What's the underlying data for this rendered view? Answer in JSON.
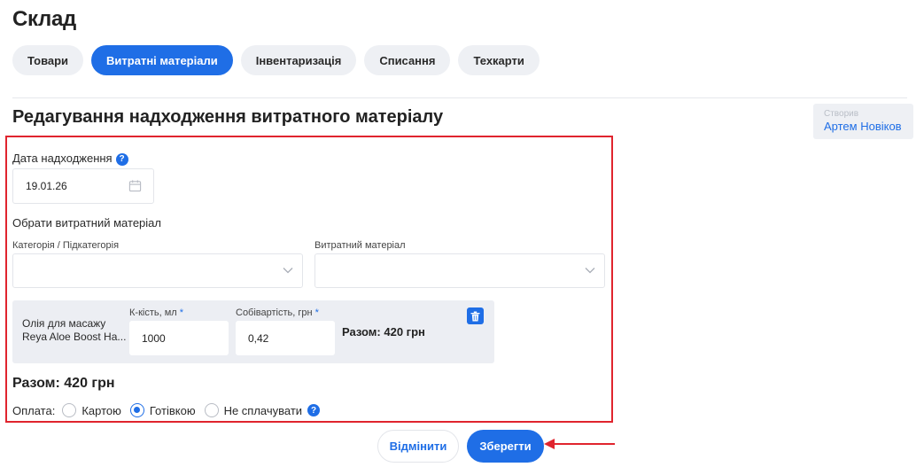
{
  "page": {
    "title": "Склад"
  },
  "tabs": [
    {
      "label": "Товари",
      "active": false
    },
    {
      "label": "Витратні матеріали",
      "active": true
    },
    {
      "label": "Інвентаризація",
      "active": false
    },
    {
      "label": "Списання",
      "active": false
    },
    {
      "label": "Техкарти",
      "active": false
    }
  ],
  "form": {
    "title": "Редагування надходження витратного матеріалу",
    "creator": {
      "label": "Створив",
      "name": "Артем Новіков"
    },
    "date": {
      "label": "Дата надходження",
      "value": "19.01.26"
    },
    "choose_label": "Обрати витратний матеріал",
    "category": {
      "label": "Категорія / Підкатегорія",
      "value": ""
    },
    "material": {
      "label": "Витратний матеріал",
      "value": ""
    },
    "item": {
      "name": "Олія для масажу Reya Aloe Boost Ha...",
      "qty_label": "К-кість, мл",
      "qty_value": "1000",
      "cost_label": "Собівартість, грн",
      "cost_value": "0,42",
      "line_total": "Разом: 420 грн"
    },
    "total": "Разом: 420 грн",
    "payment": {
      "label": "Оплата:",
      "options": [
        {
          "label": "Картою",
          "selected": false
        },
        {
          "label": "Готівкою",
          "selected": true
        },
        {
          "label": "Не сплачувати",
          "selected": false
        }
      ]
    },
    "cancel_label": "Відмінити",
    "save_label": "Зберегти"
  },
  "colors": {
    "accent": "#1f6ee6",
    "highlight": "#e0242e",
    "tab_bg": "#eef0f4",
    "card_bg": "#eceef3"
  },
  "icons": {
    "date": "calendar-icon",
    "select": "chevron-down-icon",
    "delete": "trash-icon",
    "help": "help-icon",
    "annotation": "arrow-left-icon"
  }
}
